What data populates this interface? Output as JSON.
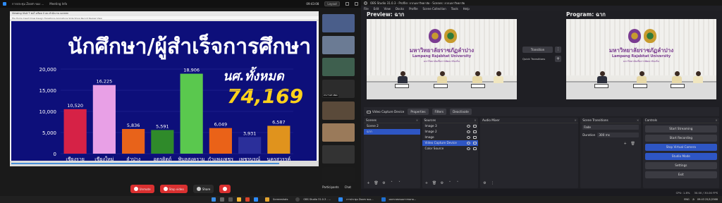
{
  "zoom": {
    "window_title": "การประชุม Zoom ของ ...",
    "meeting_info": "Meeting Info",
    "time": "09:43:08",
    "layout_btn": "Layout",
    "viewing": "Viewing Visit T ต่อไ มหิดล ll ลด สำนักงาน screen",
    "slide_menu": "File  Home  Insert  Draw  Design  Transitions  Animations  Slide Show  Record  Review  View",
    "slide": {
      "title": "นักศึกษา/ผู้สำเร็จการศึกษา",
      "total_label": "นศ.ทั้งหมด",
      "total_value": "74,169"
    },
    "thumbnails": [
      {
        "label": "",
        "color": "#4a5e8a"
      },
      {
        "label": "",
        "color": "#6b7b94"
      },
      {
        "label": "",
        "color": "#3e5f4e"
      },
      {
        "label": "ท่าน T ต่อไ มหิดล",
        "color": "#2c2c2c"
      },
      {
        "label": "",
        "color": "#5a4a3a"
      },
      {
        "label": "",
        "color": "#9a7a5a"
      },
      {
        "label": "",
        "color": "#333"
      },
      {
        "label": "RMUTK",
        "color": "#1b1b1b"
      },
      {
        "label": "",
        "color": "#7a6a5a"
      }
    ],
    "controls": {
      "unmute": "Unmute",
      "stop_video": "Stop video",
      "share": "Share",
      "participants": "Participants",
      "chat": "Chat"
    }
  },
  "chart_data": {
    "type": "bar",
    "categories": [
      "เชียงราย",
      "เชียงใหม่",
      "ลำปาง",
      "อุตรดิตถ์",
      "พิบูลสงคราม",
      "กำแพงเพชร",
      "เพชรบูรณ์",
      "นครสวรรค์"
    ],
    "values": [
      10520,
      16225,
      5836,
      5591,
      18906,
      6049,
      3931,
      6587
    ],
    "value_labels": [
      "10,520",
      "16,225",
      "5,836",
      "5,591",
      "18,906",
      "6,049",
      "3,931",
      "6,587"
    ],
    "colors": [
      "#d62246",
      "#e8a0e6",
      "#e8631a",
      "#2f8a2a",
      "#5ac84e",
      "#ea6218",
      "#2b2f9a",
      "#e0931d"
    ],
    "yticks": [
      "20,000",
      "15,000",
      "10,000",
      "5,000",
      "0"
    ],
    "ylim": [
      0,
      20000
    ],
    "title": "นักศึกษา/ผู้สำเร็จการศึกษา"
  },
  "obs": {
    "title": "OBS Studio 31.0.3 - Profile: ลวกมหาวิทยาลัย - Scenes: ลวกมหาวิทยาลัย",
    "menu": [
      "File",
      "Edit",
      "View",
      "Docks",
      "Profile",
      "Scene Collection",
      "Tools",
      "Help"
    ],
    "preview_label": "Preview: ฉาก",
    "program_label": "Program: ฉาก",
    "transition_btn": "Transition",
    "quick_transitions": "Quick Transitions",
    "canvas": {
      "uni_th": "มหาวิทยาลัยราชภัฏลำปาง",
      "uni_en": "Lampang Rajabhat University",
      "uni_sub": "มหาวิทยาลัยเพื่อการพัฒนาท้องถิ่น"
    },
    "source_bar": {
      "source_name": "Video Capture Device",
      "properties": "Properties",
      "filters": "Filters",
      "deactivate": "Deactivate"
    },
    "docks": {
      "scenes": {
        "title": "Scenes",
        "items": [
          "Scene 2",
          "ฉาก"
        ],
        "selected": 1
      },
      "sources": {
        "title": "Sources",
        "items": [
          "Image 3",
          "Image 2",
          "Image",
          "Video Capture Device",
          "Color Source"
        ],
        "selected": 3
      },
      "audio": {
        "title": "Audio Mixer"
      },
      "transitions": {
        "title": "Scene Transitions",
        "type": "Fade",
        "duration_label": "Duration",
        "duration": "300 ms"
      },
      "controls": {
        "title": "Controls",
        "buttons": [
          "Start Streaming",
          "Start Recording",
          "Stop Virtual Camera",
          "Studio Mode",
          "Settings",
          "Exit"
        ]
      }
    },
    "status": {
      "cpu": "CPU: 1.8%",
      "fps": "30.00 / 30.00 FPS"
    }
  },
  "taskbar": {
    "apps": [
      "Screenshots",
      "OBS Studio 31.0.3 - ...",
      "การประชุม Zoom ของ...",
      "ผลกระทบของการขยาย..."
    ],
    "time": "09:43",
    "date": "25/1/2568",
    "lang": "ENG"
  }
}
